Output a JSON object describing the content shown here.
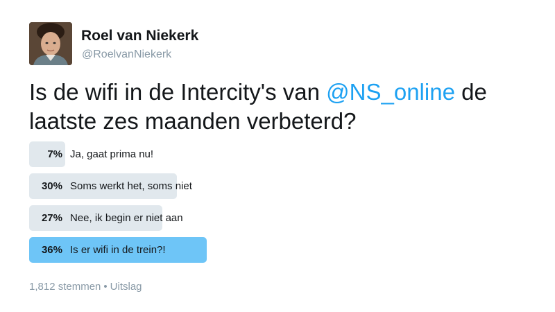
{
  "author": {
    "name": "Roel van Niekerk",
    "handle": "@RoelvanNiekerk",
    "avatar": "profile-photo"
  },
  "tweet": {
    "text_before": "Is de wifi in de Intercity's van ",
    "mention": "@NS_online",
    "text_after": " de laatste zes maanden verbeterd?"
  },
  "poll": {
    "options": [
      {
        "percent_label": "7%",
        "label": "Ja, gaat prima nu!",
        "percent": 7,
        "winner": false
      },
      {
        "percent_label": "30%",
        "label": "Soms werkt het, soms niet",
        "percent": 30,
        "winner": false
      },
      {
        "percent_label": "27%",
        "label": "Nee, ik begin er niet aan",
        "percent": 27,
        "winner": false
      },
      {
        "percent_label": "36%",
        "label": "Is er wifi in de trein?!",
        "percent": 36,
        "winner": true
      }
    ],
    "votes": "1,812 stemmen",
    "separator": "•",
    "status": "Uitslag"
  },
  "colors": {
    "bar": "#e1e8ed",
    "winner_bar": "#6ec5f7",
    "mention": "#1da1f2",
    "muted": "#8899a6"
  }
}
